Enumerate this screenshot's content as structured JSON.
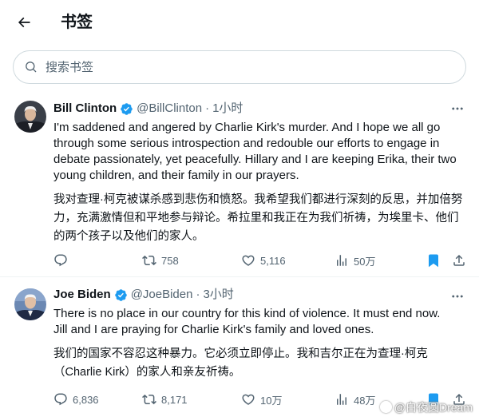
{
  "header": {
    "title": "书签"
  },
  "search": {
    "placeholder": "搜索书签"
  },
  "posts": [
    {
      "name": "Bill Clinton",
      "handle": "@BillClinton",
      "time": "1小时",
      "text_en": "I'm saddened and angered by Charlie Kirk's murder. And I hope we all go through some serious introspection and redouble our efforts to engage in debate passionately, yet peacefully. Hillary and I are keeping Erika, their two young children, and their family in our prayers.",
      "text_zh": "我对查理·柯克被谋杀感到悲伤和愤怒。我希望我们都进行深刻的反思，并加倍努力，充满激情但和平地参与辩论。希拉里和我正在为我们祈祷，为埃里卡、他们的两个孩子以及他们的家人。",
      "replies": "",
      "reposts": "758",
      "likes": "5,116",
      "views": "50万"
    },
    {
      "name": "Joe Biden",
      "handle": "@JoeBiden",
      "time": "3小时",
      "text_en": "There is no place in our country for this kind of violence. It must end now.\nJill and I are praying for Charlie Kirk's family and loved ones.",
      "text_zh": "我们的国家不容忍这种暴力。它必须立即停止。我和吉尔正在为查理·柯克（Charlie Kirk）的家人和亲友祈祷。",
      "replies": "6,836",
      "reposts": "8,171",
      "likes": "10万",
      "views": "48万"
    }
  ],
  "watermark": "@白夜圆Dream",
  "colors": {
    "text": "#0f1419",
    "secondary": "#536471",
    "accent": "#1d9bf0",
    "border": "#eff3f4"
  },
  "icons": [
    "back-arrow-icon",
    "search-icon",
    "verified-badge-icon",
    "more-icon",
    "reply-icon",
    "repost-icon",
    "like-icon",
    "views-icon",
    "bookmark-icon",
    "share-icon"
  ]
}
